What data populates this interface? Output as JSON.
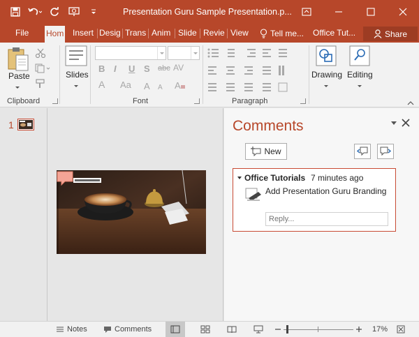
{
  "window": {
    "title": "Presentation Guru Sample Presentation.p...",
    "accent": "#b7472a"
  },
  "tabs": [
    {
      "label": "File",
      "active": false
    },
    {
      "label": "Hom",
      "active": true
    },
    {
      "label": "Insert",
      "active": false
    },
    {
      "label": "Desig",
      "active": false
    },
    {
      "label": "Trans",
      "active": false
    },
    {
      "label": "Anim",
      "active": false
    },
    {
      "label": "Slide",
      "active": false
    },
    {
      "label": "Revie",
      "active": false
    },
    {
      "label": "View",
      "active": false
    }
  ],
  "tellme": {
    "label": "Tell me..."
  },
  "account": {
    "label": "Office Tut..."
  },
  "share": {
    "label": "Share"
  },
  "ribbon": {
    "clipboard": {
      "paste": "Paste",
      "group": "Clipboard"
    },
    "slides": {
      "label": "Slides"
    },
    "font": {
      "group": "Font",
      "bold": "B",
      "italic": "I",
      "underline": "U",
      "shadow": "S",
      "strike": "abc",
      "spacing": "AV",
      "fontcolor": "A",
      "case": "Aa"
    },
    "paragraph": {
      "group": "Paragraph"
    },
    "drawing": {
      "label": "Drawing"
    },
    "editing": {
      "label": "Editing"
    }
  },
  "thumbnails": [
    {
      "number": "1"
    }
  ],
  "comments": {
    "title": "Comments",
    "new_label": "New",
    "items": [
      {
        "author": "Office Tutorials",
        "time": "7 minutes ago",
        "text": "Add Presentation Guru Branding",
        "reply_placeholder": "Reply..."
      }
    ]
  },
  "statusbar": {
    "notes": "Notes",
    "comments": "Comments",
    "zoom": "17%"
  }
}
